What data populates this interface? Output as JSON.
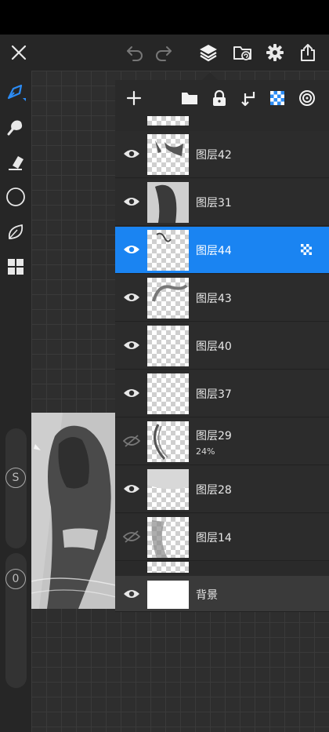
{
  "app": {
    "accent_color": "#1a84f2"
  },
  "toolbar": {
    "icons": [
      "close-icon",
      "undo-icon",
      "redo-icon",
      "layers-icon",
      "gallery-folder-icon",
      "settings-gear-icon",
      "export-share-icon"
    ]
  },
  "sidebar": {
    "tools": [
      "brush-icon",
      "smudge-icon",
      "eraser-icon",
      "color-circle-icon",
      "leaf-icon",
      "grid-icon"
    ],
    "size_slider_label": "S",
    "opacity_slider_label": "0"
  },
  "layers_panel": {
    "toolbar_icons": [
      "add-layer-icon",
      "group-folder-icon",
      "lock-icon",
      "merge-down-icon",
      "alpha-lock-icon",
      "reference-icon"
    ],
    "layers": [
      {
        "name": "图层42",
        "visible": true
      },
      {
        "name": "图层31",
        "visible": true
      },
      {
        "name": "图层44",
        "visible": true,
        "selected": true,
        "alpha_locked": true
      },
      {
        "name": "图层43",
        "visible": true
      },
      {
        "name": "图层40",
        "visible": true
      },
      {
        "name": "图层37",
        "visible": true
      },
      {
        "name": "图层29",
        "visible": false,
        "opacity": "24%"
      },
      {
        "name": "图层28",
        "visible": true
      },
      {
        "name": "图层14",
        "visible": false
      },
      {
        "name": "背景",
        "visible": true,
        "background": true
      }
    ]
  }
}
